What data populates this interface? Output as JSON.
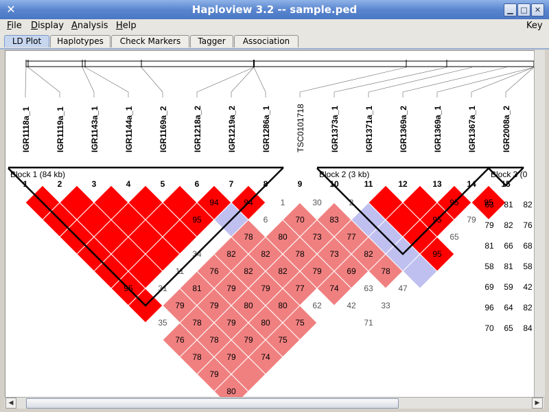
{
  "window": {
    "title": "Haploview 3.2 -- sample.ped"
  },
  "menu": {
    "items": [
      {
        "label": "File",
        "u": "F",
        "rest": "ile"
      },
      {
        "label": "Display",
        "u": "D",
        "rest": "isplay"
      },
      {
        "label": "Analysis",
        "u": "A",
        "rest": "nalysis"
      },
      {
        "label": "Help",
        "u": "H",
        "rest": "elp"
      }
    ],
    "key_label": "Key"
  },
  "tabs": [
    "LD Plot",
    "Haplotypes",
    "Check Markers",
    "Tagger",
    "Association"
  ],
  "active_tab": "LD Plot",
  "colors": {
    "red": "#ff0000",
    "white": "#ffffff",
    "lilac": "#c0c0f0",
    "block_outline": "#000000",
    "title_bar": "#5a86cf"
  },
  "ld_plot": {
    "markers": [
      {
        "num": "1",
        "name": "IGR1118a_1"
      },
      {
        "num": "2",
        "name": "IGR1119a_1"
      },
      {
        "num": "3",
        "name": "IGR1143a_1"
      },
      {
        "num": "4",
        "name": "IGR1144a_1"
      },
      {
        "num": "5",
        "name": "IGR1169a_2"
      },
      {
        "num": "6",
        "name": "IGR1218a_2"
      },
      {
        "num": "7",
        "name": "IGR1219a_2"
      },
      {
        "num": "8",
        "name": "IGR1286a_1"
      },
      {
        "num": "9",
        "name": "TSC0101718"
      },
      {
        "num": "10",
        "name": "IGR1373a_1"
      },
      {
        "num": "11",
        "name": "IGR1371a_1"
      },
      {
        "num": "12",
        "name": "IGR1369a_2"
      },
      {
        "num": "13",
        "name": "IGR1369a_1"
      },
      {
        "num": "14",
        "name": "IGR1367a_1"
      },
      {
        "num": "15",
        "name": "IGR2008a_2"
      }
    ],
    "blocks": [
      {
        "label": "Block 1 (84 kb)",
        "start": 1,
        "end": 8
      },
      {
        "label": "Block 2 (3 kb)",
        "start": 10,
        "end": 14
      },
      {
        "label": "Block 3 (0",
        "start": 15,
        "end": 15
      }
    ],
    "cells": [
      {
        "i": 1,
        "j": 2,
        "v": "",
        "c": "red"
      },
      {
        "i": 1,
        "j": 3,
        "v": "",
        "c": "red"
      },
      {
        "i": 1,
        "j": 4,
        "v": "",
        "c": "red"
      },
      {
        "i": 1,
        "j": 5,
        "v": "",
        "c": "red"
      },
      {
        "i": 1,
        "j": 6,
        "v": "",
        "c": "red"
      },
      {
        "i": 1,
        "j": 7,
        "v": "95",
        "c": "red"
      },
      {
        "i": 1,
        "j": 8,
        "v": "",
        "c": "red"
      },
      {
        "i": 1,
        "j": 9,
        "v": "35",
        "c": "white"
      },
      {
        "i": 1,
        "j": 10,
        "v": "76",
        "c": "pink"
      },
      {
        "i": 1,
        "j": 11,
        "v": "78",
        "c": "pink"
      },
      {
        "i": 1,
        "j": 12,
        "v": "79",
        "c": "pink"
      },
      {
        "i": 1,
        "j": 13,
        "v": "80",
        "c": "pink"
      },
      {
        "i": 2,
        "j": 3,
        "v": "",
        "c": "red"
      },
      {
        "i": 2,
        "j": 4,
        "v": "",
        "c": "red"
      },
      {
        "i": 2,
        "j": 5,
        "v": "",
        "c": "red"
      },
      {
        "i": 2,
        "j": 6,
        "v": "",
        "c": "red"
      },
      {
        "i": 2,
        "j": 7,
        "v": "",
        "c": "red"
      },
      {
        "i": 2,
        "j": 8,
        "v": "31",
        "c": "white"
      },
      {
        "i": 2,
        "j": 9,
        "v": "79",
        "c": "pink"
      },
      {
        "i": 2,
        "j": 10,
        "v": "78",
        "c": "pink"
      },
      {
        "i": 2,
        "j": 11,
        "v": "78",
        "c": "pink"
      },
      {
        "i": 2,
        "j": 12,
        "v": "79",
        "c": "pink"
      },
      {
        "i": 2,
        "j": 13,
        "v": "",
        "c": "pink"
      },
      {
        "i": 3,
        "j": 4,
        "v": "",
        "c": "red"
      },
      {
        "i": 3,
        "j": 5,
        "v": "",
        "c": "red"
      },
      {
        "i": 3,
        "j": 6,
        "v": "",
        "c": "red"
      },
      {
        "i": 3,
        "j": 7,
        "v": "",
        "c": "red"
      },
      {
        "i": 3,
        "j": 8,
        "v": "11",
        "c": "white"
      },
      {
        "i": 3,
        "j": 9,
        "v": "81",
        "c": "pink"
      },
      {
        "i": 3,
        "j": 10,
        "v": "79",
        "c": "pink"
      },
      {
        "i": 3,
        "j": 11,
        "v": "79",
        "c": "pink"
      },
      {
        "i": 3,
        "j": 12,
        "v": "79",
        "c": "pink"
      },
      {
        "i": 3,
        "j": 13,
        "v": "74",
        "c": "pink"
      },
      {
        "i": 4,
        "j": 5,
        "v": "",
        "c": "red"
      },
      {
        "i": 4,
        "j": 6,
        "v": "",
        "c": "red"
      },
      {
        "i": 4,
        "j": 7,
        "v": "",
        "c": "red"
      },
      {
        "i": 4,
        "j": 8,
        "v": "34",
        "c": "white"
      },
      {
        "i": 4,
        "j": 9,
        "v": "76",
        "c": "pink"
      },
      {
        "i": 4,
        "j": 10,
        "v": "79",
        "c": "pink"
      },
      {
        "i": 4,
        "j": 11,
        "v": "80",
        "c": "pink"
      },
      {
        "i": 4,
        "j": 12,
        "v": "80",
        "c": "pink"
      },
      {
        "i": 4,
        "j": 13,
        "v": "75",
        "c": "pink"
      },
      {
        "i": 5,
        "j": 6,
        "v": "",
        "c": "red"
      },
      {
        "i": 5,
        "j": 7,
        "v": "95",
        "c": "red"
      },
      {
        "i": 5,
        "j": 8,
        "v": "",
        "c": "white"
      },
      {
        "i": 5,
        "j": 9,
        "v": "82",
        "c": "pink"
      },
      {
        "i": 5,
        "j": 10,
        "v": "82",
        "c": "pink"
      },
      {
        "i": 5,
        "j": 11,
        "v": "79",
        "c": "pink"
      },
      {
        "i": 5,
        "j": 12,
        "v": "80",
        "c": "pink"
      },
      {
        "i": 5,
        "j": 13,
        "v": "75",
        "c": "pink"
      },
      {
        "i": 6,
        "j": 7,
        "v": "94",
        "c": "red"
      },
      {
        "i": 6,
        "j": 8,
        "v": "",
        "c": "lilac"
      },
      {
        "i": 6,
        "j": 9,
        "v": "78",
        "c": "pink"
      },
      {
        "i": 6,
        "j": 10,
        "v": "82",
        "c": "pink"
      },
      {
        "i": 6,
        "j": 11,
        "v": "82",
        "c": "pink"
      },
      {
        "i": 6,
        "j": 12,
        "v": "77",
        "c": "pink"
      },
      {
        "i": 6,
        "j": 13,
        "v": "62",
        "c": "white"
      },
      {
        "i": 7,
        "j": 8,
        "v": "94",
        "c": "red"
      },
      {
        "i": 7,
        "j": 9,
        "v": "6",
        "c": "white"
      },
      {
        "i": 7,
        "j": 10,
        "v": "80",
        "c": "pink"
      },
      {
        "i": 7,
        "j": 11,
        "v": "78",
        "c": "pink"
      },
      {
        "i": 7,
        "j": 12,
        "v": "79",
        "c": "pink"
      },
      {
        "i": 7,
        "j": 13,
        "v": "74",
        "c": "pink"
      },
      {
        "i": 7,
        "j": 14,
        "v": "42",
        "c": "white"
      },
      {
        "i": 7,
        "j": 15,
        "v": "71",
        "c": "white"
      },
      {
        "i": 8,
        "j": 9,
        "v": "1",
        "c": "white"
      },
      {
        "i": 8,
        "j": 10,
        "v": "70",
        "c": "pink"
      },
      {
        "i": 8,
        "j": 11,
        "v": "73",
        "c": "pink"
      },
      {
        "i": 8,
        "j": 12,
        "v": "73",
        "c": "pink"
      },
      {
        "i": 8,
        "j": 13,
        "v": "69",
        "c": "pink"
      },
      {
        "i": 8,
        "j": 14,
        "v": "63",
        "c": "white"
      },
      {
        "i": 8,
        "j": 15,
        "v": "33",
        "c": "white"
      },
      {
        "i": 9,
        "j": 10,
        "v": "30",
        "c": "white"
      },
      {
        "i": 9,
        "j": 11,
        "v": "83",
        "c": "pink"
      },
      {
        "i": 9,
        "j": 12,
        "v": "77",
        "c": "pink"
      },
      {
        "i": 9,
        "j": 13,
        "v": "82",
        "c": "pink"
      },
      {
        "i": 9,
        "j": 14,
        "v": "78",
        "c": "pink"
      },
      {
        "i": 9,
        "j": 15,
        "v": "47",
        "c": "white"
      },
      {
        "i": 10,
        "j": 11,
        "v": "2",
        "c": "white"
      },
      {
        "i": 10,
        "j": 12,
        "v": "",
        "c": "lilac"
      },
      {
        "i": 10,
        "j": 13,
        "v": "",
        "c": "lilac"
      },
      {
        "i": 10,
        "j": 14,
        "v": "",
        "c": "lilac"
      },
      {
        "i": 10,
        "j": 15,
        "v": "",
        "c": "lilac"
      },
      {
        "i": 11,
        "j": 12,
        "v": "",
        "c": "red"
      },
      {
        "i": 11,
        "j": 13,
        "v": "",
        "c": "red"
      },
      {
        "i": 11,
        "j": 14,
        "v": "",
        "c": "red"
      },
      {
        "i": 11,
        "j": 15,
        "v": "95",
        "c": "red"
      },
      {
        "i": 12,
        "j": 13,
        "v": "",
        "c": "red"
      },
      {
        "i": 12,
        "j": 14,
        "v": "95",
        "c": "red"
      },
      {
        "i": 12,
        "j": 15,
        "v": "65",
        "c": "white"
      },
      {
        "i": 13,
        "j": 14,
        "v": "95",
        "c": "red"
      },
      {
        "i": 13,
        "j": 15,
        "v": "79",
        "c": "white"
      },
      {
        "i": 14,
        "j": 15,
        "v": "95",
        "c": "red"
      }
    ],
    "right_edge_values": [
      "63",
      "81",
      "82",
      "79",
      "82",
      "76",
      "81",
      "66",
      "68",
      "58",
      "81",
      "58",
      "69",
      "59",
      "42",
      "96",
      "64",
      "82",
      "70",
      "65",
      "84"
    ]
  },
  "scroll": {
    "h_thumb_start": 0.02,
    "h_thumb_end": 0.74
  }
}
